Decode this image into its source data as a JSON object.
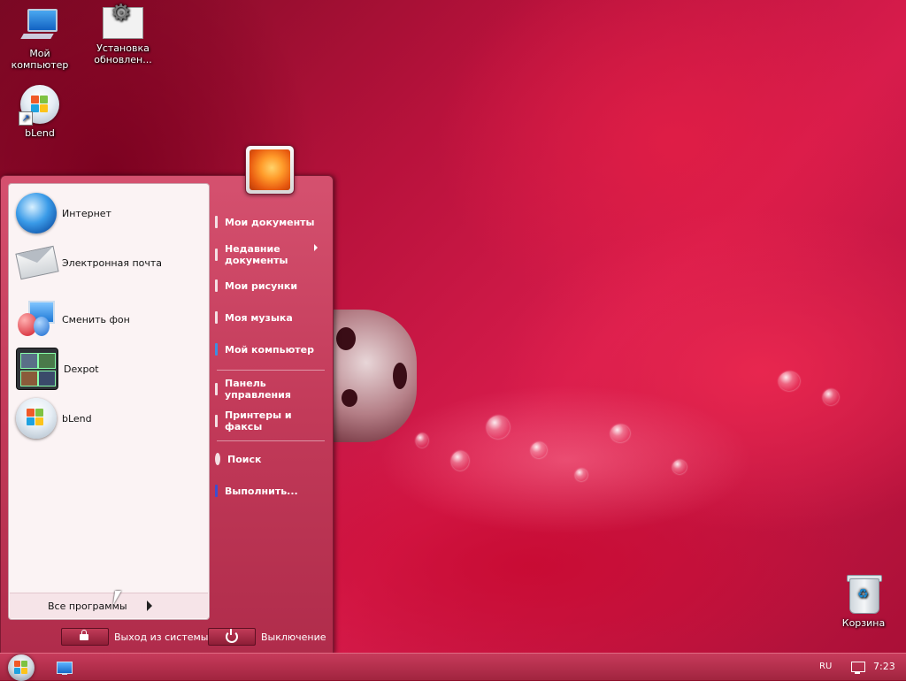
{
  "desktop": {
    "icons": [
      {
        "label": "Мой компьютер",
        "icon": "computer-icon"
      },
      {
        "label": "Установка обновлен...",
        "icon": "settings-icon"
      },
      {
        "label": "bLend",
        "icon": "windows-orb-icon"
      },
      {
        "label": "Корзина",
        "icon": "recycle-bin-icon"
      }
    ]
  },
  "start_menu": {
    "pinned": [
      {
        "label": "Интернет",
        "icon": "globe-icon"
      },
      {
        "label": "Электронная почта",
        "icon": "mail-icon"
      },
      {
        "label": "Сменить фон",
        "icon": "balloons-icon"
      },
      {
        "label": "Dexpot",
        "icon": "dexpot-icon"
      },
      {
        "label": "bLend",
        "icon": "windows-orb-icon"
      }
    ],
    "all_programs": "Все программы",
    "right": [
      {
        "label": "Мои документы"
      },
      {
        "label": "Недавние документы",
        "submenu": true
      },
      {
        "label": "Мои рисунки"
      },
      {
        "label": "Моя музыка"
      },
      {
        "label": "Мой компьютер"
      },
      {
        "label": "Панель управления"
      },
      {
        "label": "Принтеры и факсы"
      },
      {
        "label": "Поиск"
      },
      {
        "label": "Выполнить..."
      }
    ],
    "logoff_label": "Выход из системы",
    "shutdown_label": "Выключение"
  },
  "taskbar": {
    "language": "RU",
    "clock": "7:23"
  },
  "colors": {
    "accent": "#c23a59",
    "taskbar": "#a1243f"
  }
}
